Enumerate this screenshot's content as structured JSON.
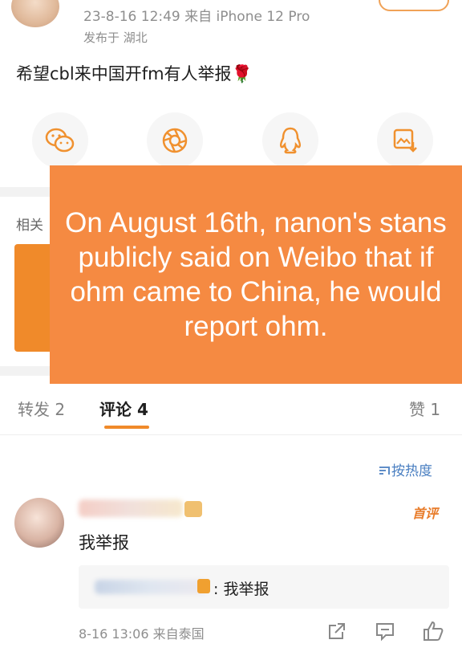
{
  "post": {
    "meta_time_device": "23-8-16 12:49  来自 iPhone 12 Pro",
    "meta_location": "发布于 湖北",
    "text": "希望cbl来中国开fm有人举报🌹"
  },
  "share": {
    "icons": [
      "wechat-icon",
      "moments-icon",
      "qq-icon",
      "save-image-icon"
    ],
    "icon_color": "#f0912f"
  },
  "related": {
    "label": "相关"
  },
  "tabs": {
    "repost": "转发 2",
    "comment": "评论 4",
    "like": "赞 1"
  },
  "sort": {
    "label": "按热度"
  },
  "comment": {
    "first_badge": "首评",
    "text": "我举报",
    "reply_text": ": 我举报",
    "meta": "8-16 13:06  来自泰国"
  },
  "overlay": {
    "text": "On August 16th, nanon's stans publicly said on Weibo that if ohm came to China, he would report ohm.",
    "background": "#f58a42",
    "text_color": "#ffffff"
  },
  "colors": {
    "accent": "#f08a2a",
    "link": "#4a7fc1"
  }
}
